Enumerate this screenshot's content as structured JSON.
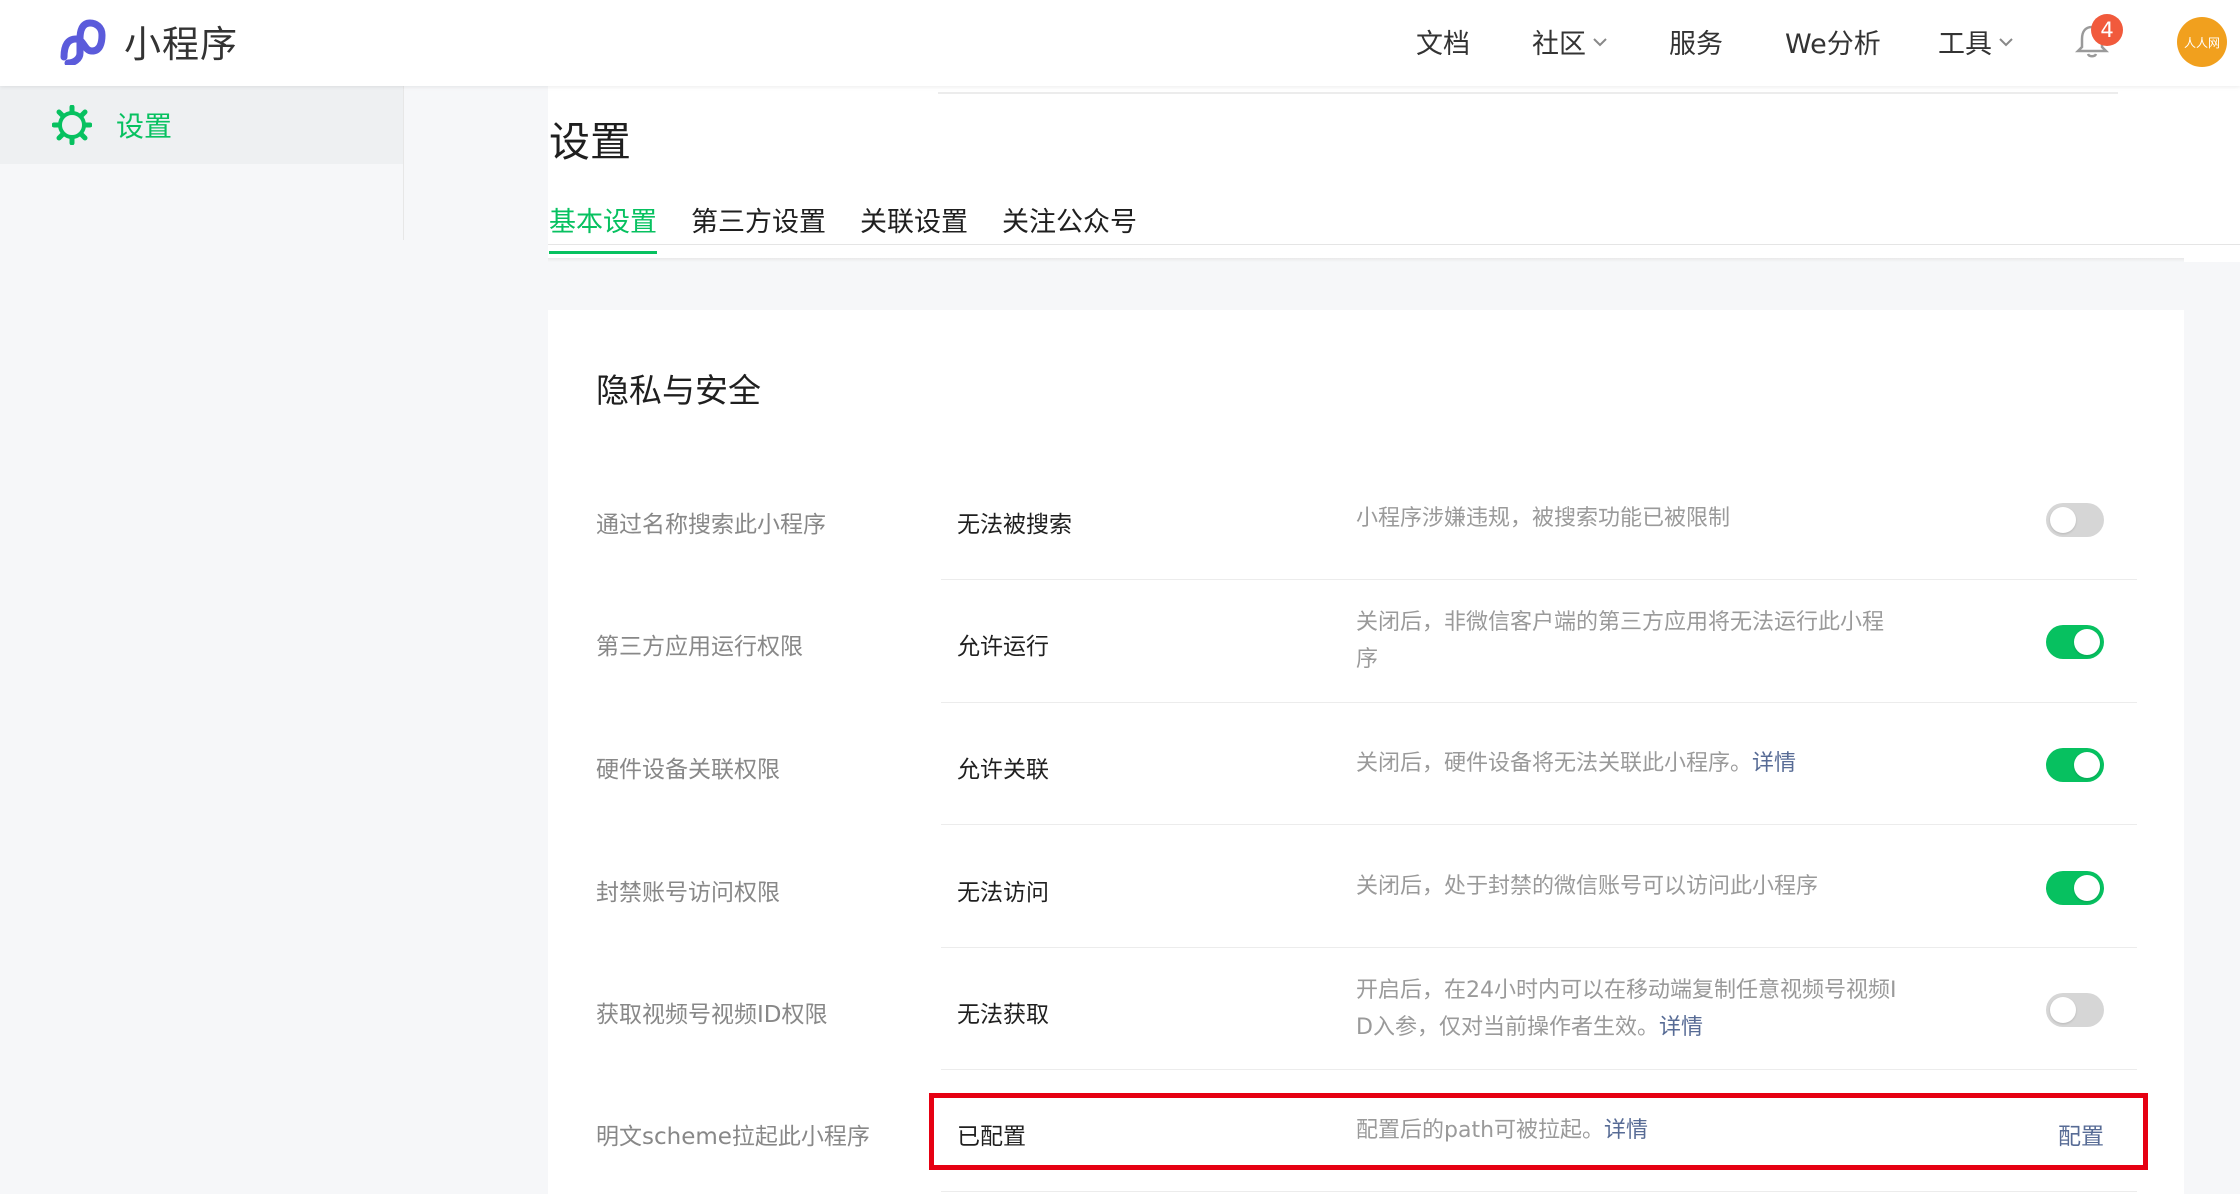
{
  "topbar": {
    "logo_text": "小程序",
    "nav": [
      {
        "label": "文档",
        "dropdown": false
      },
      {
        "label": "社区",
        "dropdown": true
      },
      {
        "label": "服务",
        "dropdown": false
      },
      {
        "label": "We分析",
        "dropdown": false
      },
      {
        "label": "工具",
        "dropdown": true
      }
    ],
    "notification_count": "4",
    "avatar_text": "人人网"
  },
  "sidebar": {
    "items": [
      {
        "label": "设置",
        "icon": "gear-icon",
        "active": true
      }
    ]
  },
  "page": {
    "title": "设置",
    "tabs": [
      {
        "label": "基本设置",
        "active": true
      },
      {
        "label": "第三方设置",
        "active": false
      },
      {
        "label": "关联设置",
        "active": false
      },
      {
        "label": "关注公众号",
        "active": false
      }
    ]
  },
  "section": {
    "title": "隐私与安全",
    "rows": [
      {
        "label": "通过名称搜索此小程序",
        "value": "无法被搜索",
        "desc": "小程序涉嫌违规，被搜索功能已被限制",
        "desc2": "",
        "link": "",
        "toggle": "off"
      },
      {
        "label": "第三方应用运行权限",
        "value": "允许运行",
        "desc": "关闭后，非微信客户端的第三方应用将无法运行此小程",
        "desc2": "序",
        "link": "",
        "toggle": "on"
      },
      {
        "label": "硬件设备关联权限",
        "value": "允许关联",
        "desc": "关闭后，硬件设备将无法关联此小程序。",
        "desc2": "",
        "link": "详情",
        "toggle": "on"
      },
      {
        "label": "封禁账号访问权限",
        "value": "无法访问",
        "desc": "关闭后，处于封禁的微信账号可以访问此小程序",
        "desc2": "",
        "link": "",
        "toggle": "on"
      },
      {
        "label": "获取视频号视频ID权限",
        "value": "无法获取",
        "desc": "开启后，在24小时内可以在移动端复制任意视频号视频I",
        "desc2": "D入参，仅对当前操作者生效。",
        "link": "详情",
        "toggle": "off"
      },
      {
        "label": "明文scheme拉起此小程序",
        "value": "已配置",
        "desc": "配置后的path可被拉起。",
        "desc2": "",
        "link": "详情",
        "action": "配置"
      }
    ]
  },
  "colors": {
    "accent": "#07c160",
    "link": "#576b95",
    "highlight": "#e60012",
    "badge": "#f15a3c"
  }
}
